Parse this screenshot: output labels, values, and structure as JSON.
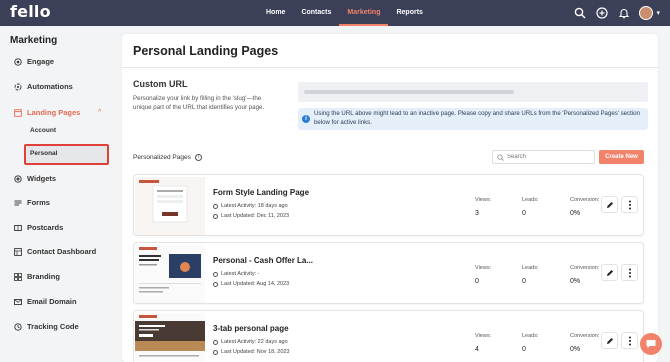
{
  "app": {
    "logo": "fello"
  },
  "topnav": {
    "items": [
      {
        "label": "Home"
      },
      {
        "label": "Contacts"
      },
      {
        "label": "Marketing",
        "active": true
      },
      {
        "label": "Reports"
      }
    ]
  },
  "sidebar": {
    "title": "Marketing",
    "items": [
      {
        "label": "Engage",
        "icon": "target-icon"
      },
      {
        "label": "Automations",
        "icon": "automation-icon"
      },
      {
        "label": "Landing Pages",
        "icon": "landing-pages-icon",
        "active": true
      },
      {
        "label": "Widgets",
        "icon": "widgets-icon"
      },
      {
        "label": "Forms",
        "icon": "forms-icon"
      },
      {
        "label": "Postcards",
        "icon": "postcard-icon"
      },
      {
        "label": "Contact Dashboard",
        "icon": "dashboard-icon"
      },
      {
        "label": "Branding",
        "icon": "branding-icon"
      },
      {
        "label": "Email Domain",
        "icon": "email-icon"
      },
      {
        "label": "Tracking Code",
        "icon": "tracking-icon"
      }
    ],
    "subitems": [
      {
        "label": "Account"
      },
      {
        "label": "Personal",
        "selected": true
      }
    ]
  },
  "main": {
    "title": "Personal Landing Pages",
    "custom_url": {
      "title": "Custom URL",
      "description": "Personalize your link by filling in the 'slug'—the unique part of the URL that identifies your page.",
      "info": "Using the URL above might lead to an inactive page. Please copy and share URLs from the 'Personalized Pages' section below for active links."
    },
    "personalized": {
      "title": "Personalized Pages",
      "search_placeholder": "Search",
      "create_label": "Create New"
    },
    "stat_labels": {
      "views": "Views:",
      "leads": "Leads:",
      "conversion": "Conversion:"
    },
    "pages": [
      {
        "name": "Form Style Landing Page",
        "latest_activity": "Latest Activity: 18 days ago",
        "last_updated": "Last Updated: Dec 11, 2023",
        "views": "3",
        "leads": "0",
        "conversion": "0%"
      },
      {
        "name": "Personal - Cash Offer La...",
        "latest_activity": "Latest Activity: -",
        "last_updated": "Last Updated: Aug 14, 2023",
        "views": "0",
        "leads": "0",
        "conversion": "0%"
      },
      {
        "name": "3-tab personal page",
        "latest_activity": "Latest Activity: 22 days ago",
        "last_updated": "Last Updated: Nov 18, 2023",
        "views": "4",
        "leads": "0",
        "conversion": "0%"
      }
    ]
  },
  "colors": {
    "topbar": "#3b3f57",
    "accent": "#f2836b",
    "info_bg": "#e4effa"
  }
}
